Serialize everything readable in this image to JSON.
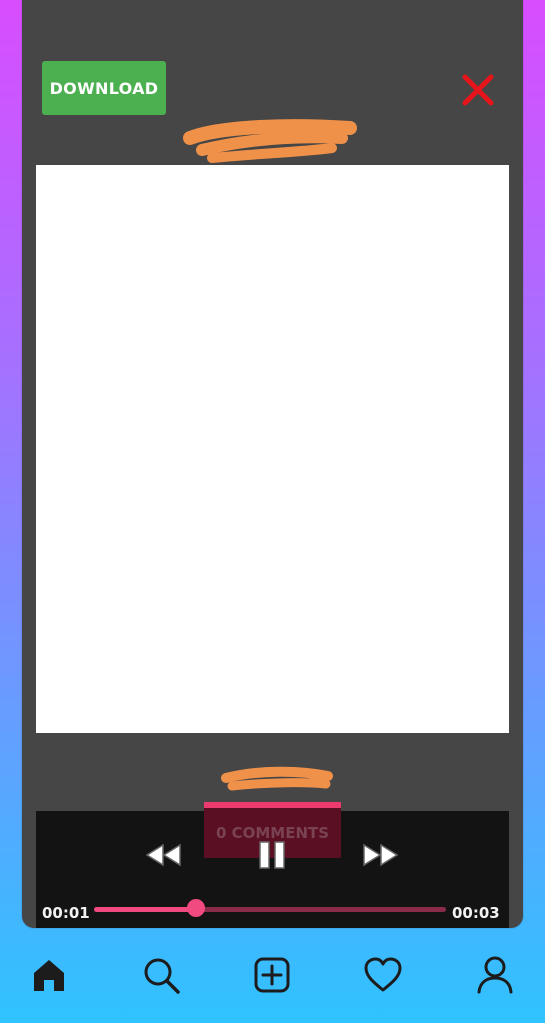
{
  "header": {
    "download_label": "DOWNLOAD",
    "close_icon": "close-icon"
  },
  "comments": {
    "label": "0 COMMENTS"
  },
  "player": {
    "current_time": "00:01",
    "total_time": "00:03",
    "progress_fraction": 0.29,
    "icons": [
      "rewind-icon",
      "pause-icon",
      "fast-forward-icon"
    ]
  },
  "bottom_nav": {
    "items": [
      "home-icon",
      "search-icon",
      "add-icon",
      "heart-icon",
      "profile-icon"
    ]
  },
  "colors": {
    "download_bg": "#4caf50",
    "close": "#e8141c",
    "accent": "#f04a80",
    "panel": "#464646",
    "redaction": "#f0914a"
  }
}
